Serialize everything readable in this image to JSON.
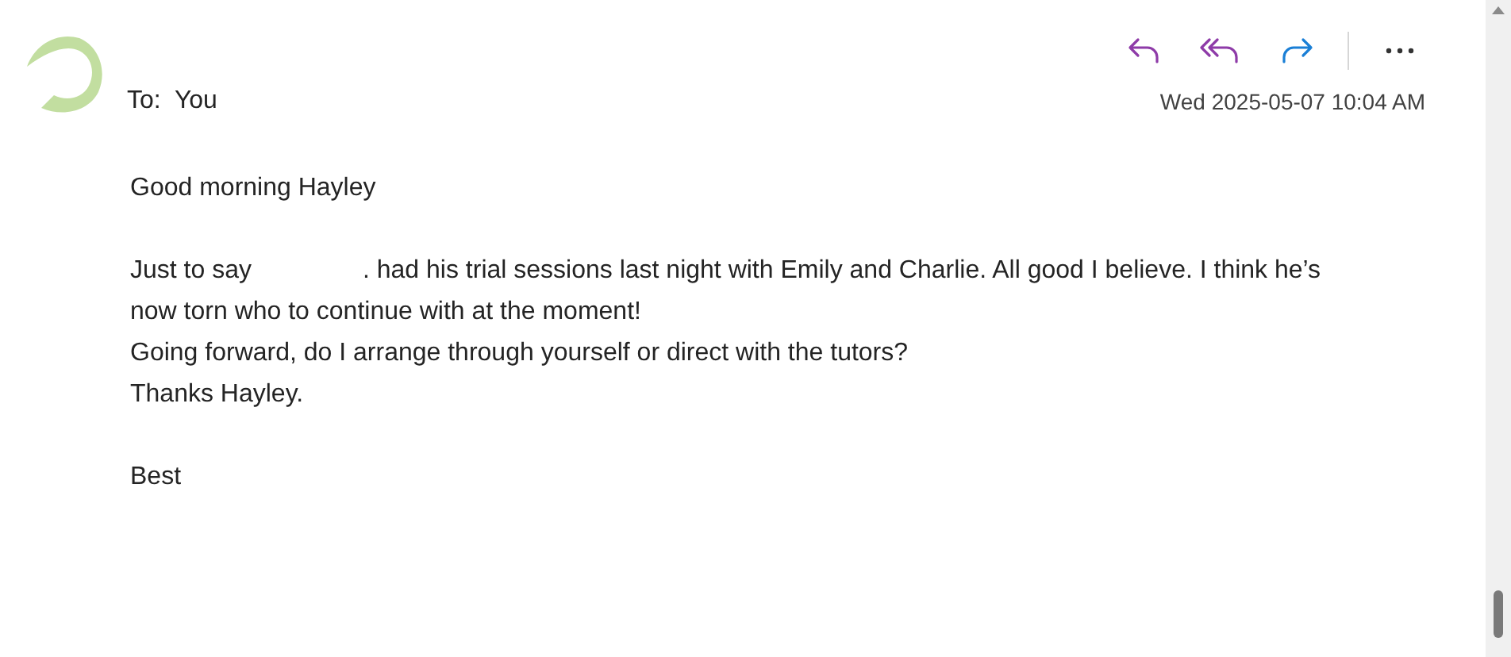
{
  "header": {
    "to_label": "To:",
    "to_value": "You",
    "date": "Wed 2025-05-07 10:04 AM"
  },
  "actions": [
    {
      "kind": "reply"
    },
    {
      "kind": "reply_all"
    },
    {
      "kind": "forward"
    },
    {
      "kind": "more"
    }
  ],
  "body": {
    "greeting": "Good morning Hayley",
    "paragraph": [
      "Just to say",
      ". had his trial sessions last night with Emily and Charlie. All good I believe.  I think he’s now torn who to continue with at the moment!"
    ],
    "lines": [
      "Going forward, do I arrange through yourself or direct with the tutors?",
      "Thanks Hayley."
    ],
    "signoff": "Best"
  }
}
